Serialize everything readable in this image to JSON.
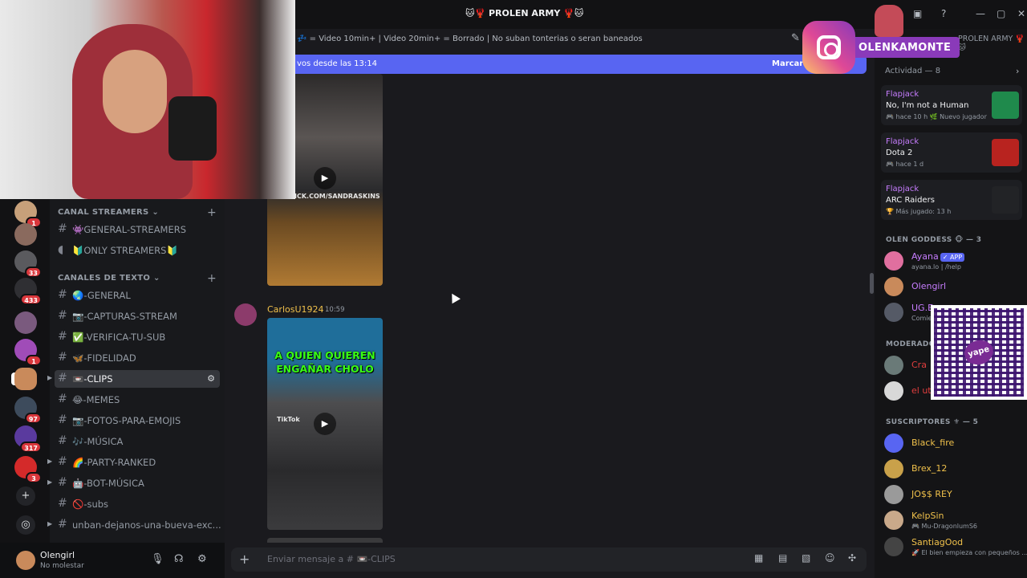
{
  "window": {
    "title": "🐱🦞 PROLEN ARMY 🦞🐱"
  },
  "topic": {
    "text": "💤 = Video 10min+ | Video 20min+ = Borrado | No suban tonterias o seran baneados"
  },
  "new_messages": {
    "text": "vos desde las 13:14",
    "action": "Marcar co"
  },
  "rail": {
    "badges": [
      "1",
      "33",
      "433",
      "1",
      "97",
      "317",
      "3"
    ]
  },
  "categories": {
    "streamers": "CANAL STREAMERS",
    "text": "CANALES DE TEXTO"
  },
  "channels": [
    {
      "name": "👾GENERAL-STREAMERS"
    },
    {
      "name": "🔰ONLY STREAMERS🔰"
    },
    {
      "name": "🌏-GENERAL"
    },
    {
      "name": "📷-CAPTURAS-STREAM"
    },
    {
      "name": "✅-VERIFICA-TU-SUB"
    },
    {
      "name": "🦋-FIDELIDAD"
    },
    {
      "name": "📼-CLIPS"
    },
    {
      "name": "😂-MEMES"
    },
    {
      "name": "📷-FOTOS-PARA-EMOJIS"
    },
    {
      "name": "🎶-MÚSICA"
    },
    {
      "name": "🌈-PARTY-RANKED"
    },
    {
      "name": "🤖-BOT-MÚSICA"
    },
    {
      "name": "🚫-subs"
    },
    {
      "name": "unban-dejanos-una-bueva-exc..."
    }
  ],
  "user": {
    "name": "Olengirl",
    "status": "No molestar"
  },
  "messages": {
    "author": "CarlosU1924",
    "time": "10:59",
    "clip1_watermark": "ICK.COM/SANDRASKINS",
    "clip2_headline": "A QUIEN QUIEREN ENGAÑAR CHOLO",
    "clip2_watermark": "TikTok"
  },
  "composer": {
    "placeholder": "Enviar mensaje a # 📼-CLIPS"
  },
  "sidebar": {
    "server_name": "PROLEN ARMY 🦞🐱",
    "activity_header": "Actividad — 8",
    "activities": [
      {
        "user": "Flapjack",
        "game": "No, I'm not a Human",
        "meta": "🎮 hace 10 h  🌿 Nuevo jugador",
        "color": "#1f8a4c"
      },
      {
        "user": "Flapjack",
        "game": "Dota 2",
        "meta": "🎮 hace 1 d",
        "color": "#b8231f"
      },
      {
        "user": "Flapjack",
        "game": "ARC Raiders",
        "meta": "🏆 Más jugado: 13 h",
        "color": "#222326"
      }
    ],
    "groups": [
      {
        "label": "OLEN GODDESS 🐵 — 3",
        "members": [
          {
            "name": "Ayana",
            "sub": "ayana.lo | /help",
            "tag": "✓ APP",
            "color": "#c77dff",
            "avatar": "#e06f9f"
          },
          {
            "name": "Olengirl",
            "sub": "",
            "tag": "",
            "color": "#c77dff",
            "avatar": "#c98a5b"
          },
          {
            "name": "UG.E",
            "sub": "Comie",
            "tag": "",
            "color": "#c77dff",
            "avatar": "#555a66"
          }
        ]
      },
      {
        "label": "MODERADO",
        "members": [
          {
            "name": "Cra",
            "sub": "",
            "tag": "",
            "color": "#e03e3e",
            "avatar": "#6a7a78"
          },
          {
            "name": "el ut",
            "sub": "",
            "tag": "",
            "color": "#e03e3e",
            "avatar": "#d8d8d8"
          }
        ]
      },
      {
        "label": "SUSCRIPTORES ⚜ — 5",
        "members": [
          {
            "name": "Black_fire",
            "sub": "",
            "tag": "",
            "color": "#f0c14b",
            "avatar": "#5865f2"
          },
          {
            "name": "Brex_12",
            "sub": "",
            "tag": "",
            "color": "#f0c14b",
            "avatar": "#c9a14a"
          },
          {
            "name": "JO$$ REY",
            "sub": "",
            "tag": "",
            "color": "#f0c14b",
            "avatar": "#9a9a9a"
          },
          {
            "name": "KelpSin",
            "sub": "🎮 Mu-DragonlumS6",
            "tag": "",
            "color": "#f0c14b",
            "avatar": "#c9a98a"
          },
          {
            "name": "SantiagOod",
            "sub": "🚀 El bien empieza con pequeños ...",
            "tag": "",
            "color": "#f0c14b",
            "avatar": "#444"
          }
        ]
      }
    ]
  },
  "overlays": {
    "instagram_handle": "OLENKAMONTE",
    "qr_brand": "yape"
  }
}
